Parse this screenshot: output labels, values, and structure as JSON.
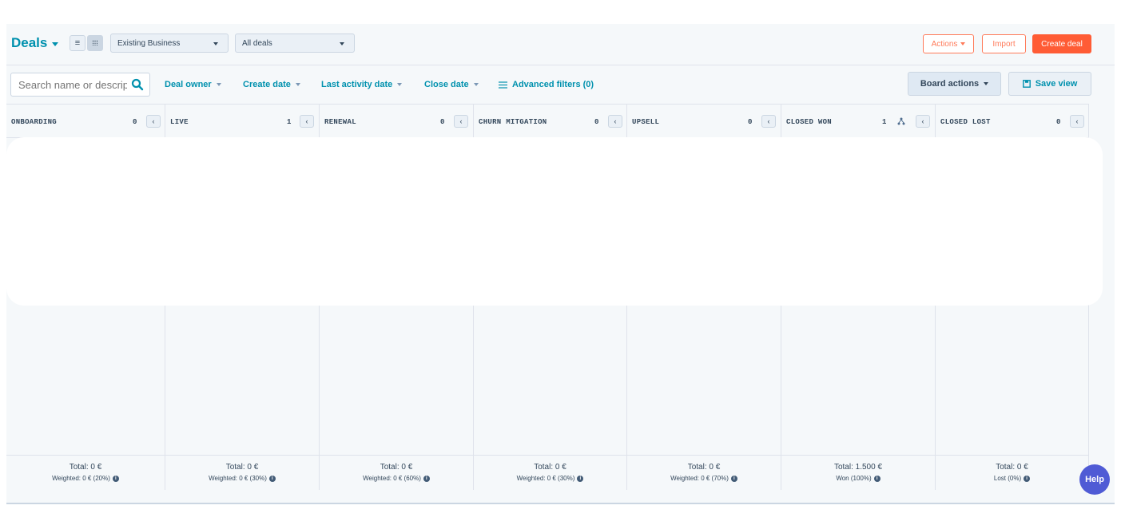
{
  "header": {
    "title": "Deals",
    "pipeline_select": "Existing Business",
    "view_select": "All deals",
    "actions_label": "Actions",
    "import_label": "Import",
    "create_label": "Create deal"
  },
  "filters": {
    "search_placeholder": "Search name or description",
    "deal_owner": "Deal owner",
    "create_date": "Create date",
    "last_activity_date": "Last activity date",
    "close_date": "Close date",
    "advanced_filters": "Advanced filters (0)",
    "board_actions": "Board actions",
    "save_view": "Save view"
  },
  "columns": [
    {
      "name": "ONBOARDING",
      "count": "0",
      "total": "Total: 0 €",
      "weighted": "Weighted: 0 € (20%)"
    },
    {
      "name": "LIVE",
      "count": "1",
      "total": "Total: 0 €",
      "weighted": "Weighted: 0 € (30%)"
    },
    {
      "name": "RENEWAL",
      "count": "0",
      "total": "Total: 0 €",
      "weighted": "Weighted: 0 € (60%)"
    },
    {
      "name": "CHURN MITGATION",
      "count": "0",
      "total": "Total: 0 €",
      "weighted": "Weighted: 0 € (30%)"
    },
    {
      "name": "UPSELL",
      "count": "0",
      "total": "Total: 0 €",
      "weighted": "Weighted: 0 € (70%)"
    },
    {
      "name": "CLOSED WON",
      "count": "1",
      "total": "Total: 1.500 €",
      "weighted": "Won (100%)"
    },
    {
      "name": "CLOSED LOST",
      "count": "0",
      "total": "Total: 0 €",
      "weighted": "Lost (0%)"
    }
  ],
  "help_label": "Help",
  "colors": {
    "accent": "#0091ae",
    "primary": "#ff5c35",
    "help": "#4f5bd5"
  },
  "icons": {
    "list_view": "list-icon",
    "board_view": "grid-icon",
    "search": "search-icon",
    "filters": "filter-lines-icon",
    "save": "save-icon",
    "collapse": "chevron-left-icon"
  }
}
